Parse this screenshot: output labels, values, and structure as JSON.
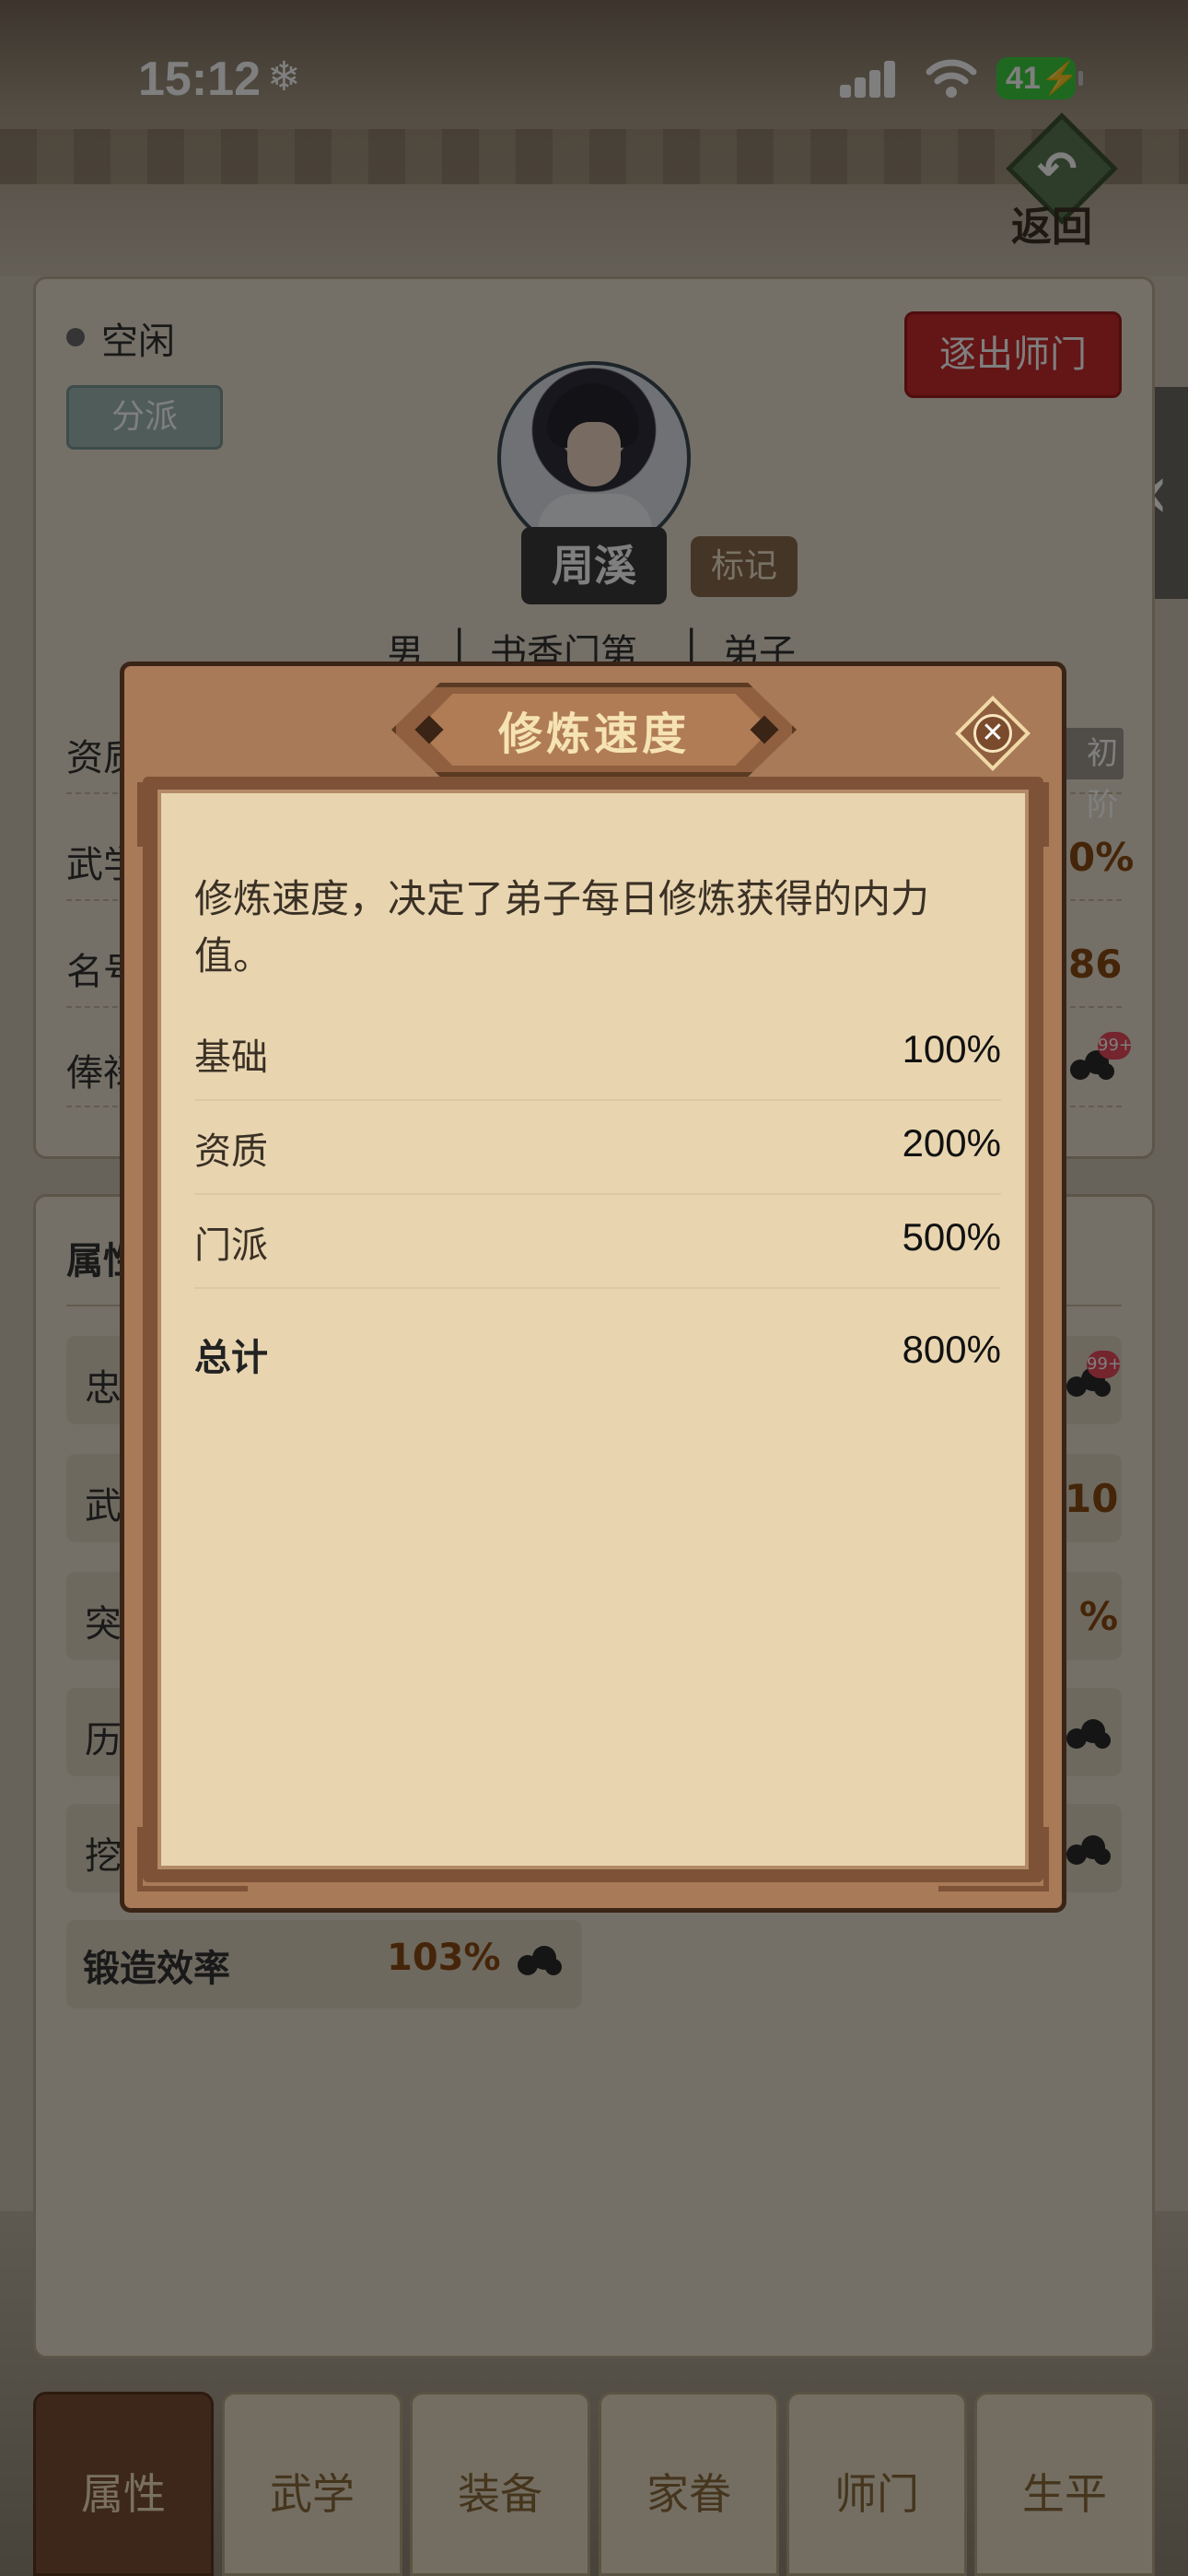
{
  "status_bar": {
    "time": "15:12",
    "battery": "41"
  },
  "header": {
    "back_label": "返回"
  },
  "disciple": {
    "status": "空闲",
    "branch_button": "分派",
    "expel_button": "逐出师门",
    "name": "周溪",
    "mark_button": "标记",
    "gender": "男",
    "background": "书香门第",
    "rank": "弟子",
    "row_labels": [
      "资质",
      "武学",
      "名号",
      "俸禄"
    ],
    "row_values": [
      "0%",
      "86"
    ],
    "stage_badge": "初阶"
  },
  "attributes": {
    "title": "属性",
    "row_labels": [
      "忠",
      "武",
      "突",
      "历",
      "挖"
    ],
    "row_values": [
      "10",
      "%"
    ],
    "forge_label": "锻造效率",
    "forge_value": "103%",
    "badge": "99+"
  },
  "tabs": [
    {
      "label": "属性",
      "active": true
    },
    {
      "label": "武学",
      "active": false
    },
    {
      "label": "装备",
      "active": false
    },
    {
      "label": "家眷",
      "active": false
    },
    {
      "label": "师门",
      "active": false
    },
    {
      "label": "生平",
      "active": false
    }
  ],
  "modal": {
    "title": "修炼速度",
    "description": "修炼速度，决定了弟子每日修炼获得的内力值。",
    "rows": [
      {
        "label": "基础",
        "value": "100%"
      },
      {
        "label": "资质",
        "value": "200%"
      },
      {
        "label": "门派",
        "value": "500%"
      }
    ],
    "total": {
      "label": "总计",
      "value": "800%"
    }
  },
  "colors": {
    "accent_red": "#c92b2b",
    "modal_frame": "#a87a58",
    "modal_body": "#e8d5b0",
    "value_brown": "#8a4b12"
  },
  "icons": [
    "snowflake-icon",
    "signal-icon",
    "wifi-icon",
    "battery-icon",
    "back-arrow-icon",
    "close-icon",
    "chevron-left-icon",
    "ink-blot-icon"
  ]
}
